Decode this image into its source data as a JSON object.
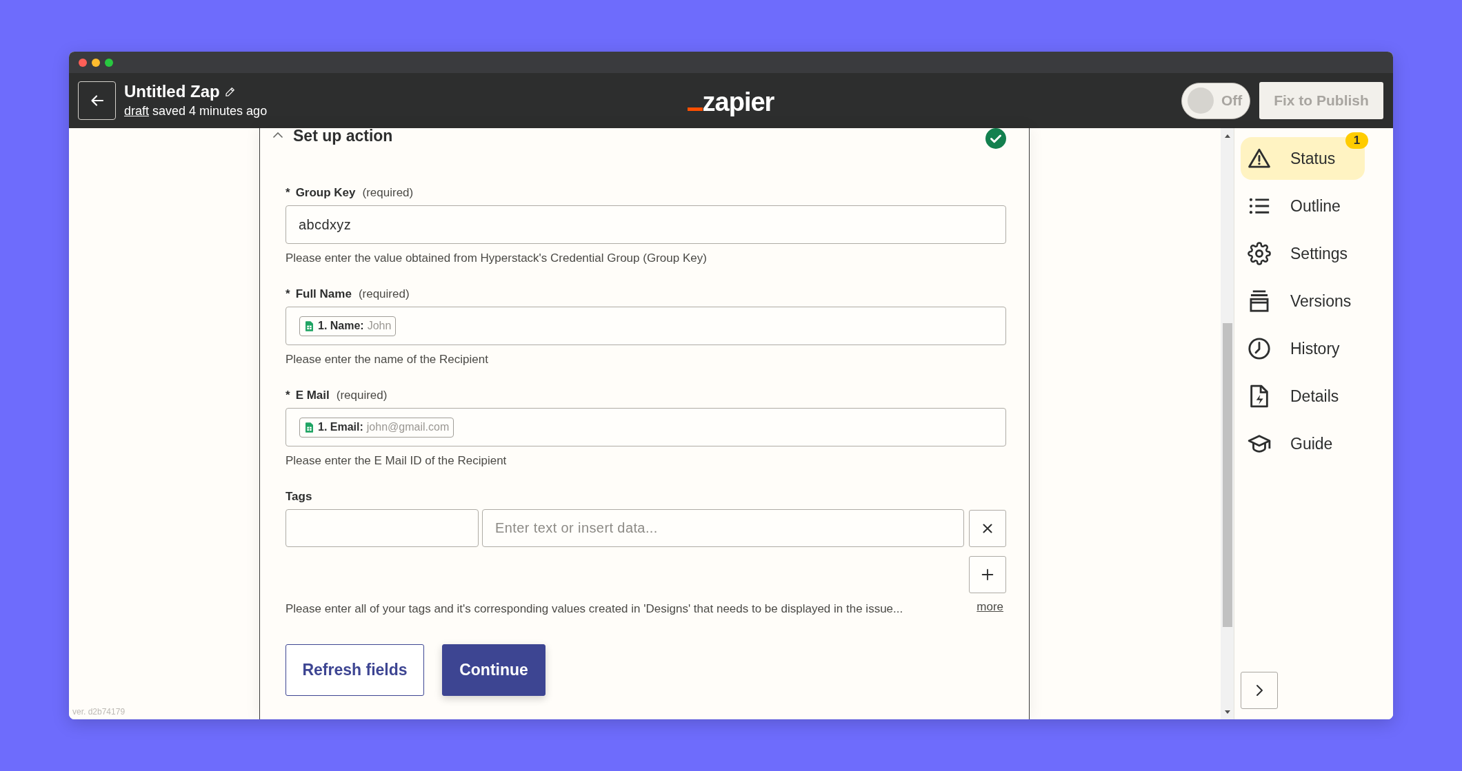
{
  "header": {
    "title": "Untitled Zap",
    "status_link": "draft",
    "status_text": "saved 4 minutes ago",
    "logo": "zapier",
    "toggle": {
      "on": false,
      "label": "Off"
    },
    "publish_button": {
      "label": "Fix to Publish",
      "disabled": true
    }
  },
  "section": {
    "title": "Set up action",
    "expanded": true,
    "complete": true,
    "fields": [
      {
        "kind": "text",
        "required_mark": "*",
        "label": "Group Key",
        "note": "(required)",
        "value": "abcdxyz",
        "help": "Please enter the value obtained from Hyperstack's Credential Group (Group Key)"
      },
      {
        "kind": "pill",
        "required_mark": "*",
        "label": "Full Name",
        "note": "(required)",
        "pill": {
          "label": "1. Name:",
          "value": "John"
        },
        "help": "Please enter the name of the Recipient"
      },
      {
        "kind": "pill",
        "required_mark": "*",
        "label": "E Mail",
        "note": "(required)",
        "pill": {
          "label": "1. Email:",
          "value": "john@gmail.com"
        },
        "help": "Please enter the E Mail ID of the Recipient"
      },
      {
        "kind": "pairs",
        "label": "Tags",
        "rows": [
          {
            "placeholder": "Enter text or insert data..."
          }
        ],
        "help": "Please enter all of your tags and it's corresponding values created in 'Designs' that needs to be displayed in the issue...",
        "more_link": "more"
      }
    ],
    "buttons": [
      {
        "label": "Refresh fields",
        "kind": "secondary"
      },
      {
        "label": "Continue",
        "kind": "primary"
      }
    ]
  },
  "sidebar": {
    "items": [
      {
        "label": "Status",
        "selected": true,
        "badge": "1"
      },
      {
        "label": "Outline",
        "selected": false
      },
      {
        "label": "Settings",
        "selected": false
      },
      {
        "label": "Versions",
        "selected": false
      },
      {
        "label": "History",
        "selected": false
      },
      {
        "label": "Details",
        "selected": false
      },
      {
        "label": "Guide",
        "selected": false
      }
    ]
  },
  "version": "ver. d2b74179"
}
